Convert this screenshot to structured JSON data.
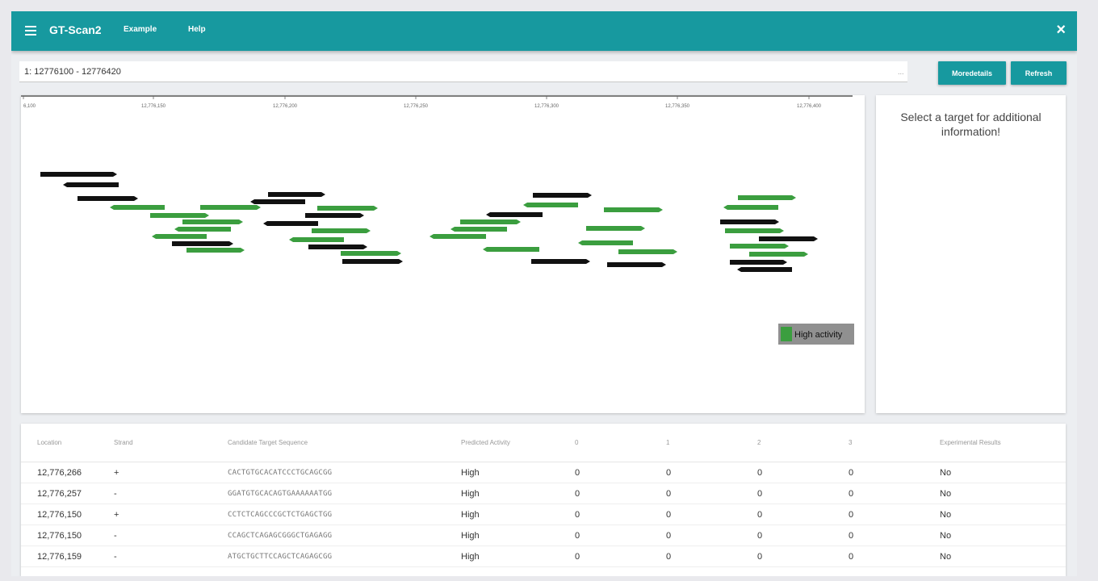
{
  "header": {
    "title": "GT-Scan2",
    "nav": [
      "Example",
      "Help"
    ],
    "close_symbol": "×"
  },
  "search": {
    "value": "1: 12776100 - 12776420",
    "trailing": "..."
  },
  "buttons": {
    "more_details": "Moredetails",
    "refresh": "Refresh"
  },
  "ruler": {
    "ticks": [
      "6,100",
      "12,776,150",
      "12,776,200",
      "12,776,250",
      "12,776,300",
      "12,776,350",
      "12,776,400"
    ]
  },
  "legend": {
    "label": "High activity",
    "color": "#3b9e3f"
  },
  "colors": {
    "accent": "#17999f",
    "high_activity": "#3b9e3f",
    "other": "#111111"
  },
  "info_panel": {
    "message": "Select a target for additional information!"
  },
  "table": {
    "columns": [
      "Location",
      "Strand",
      "Candidate Target Sequence",
      "Predicted Activity",
      "0",
      "1",
      "2",
      "3",
      "Experimental Results"
    ],
    "rows": [
      [
        "12,776,266",
        "+",
        "CACTGTGCACATCCCTGCAGCGG",
        "High",
        "0",
        "0",
        "0",
        "0",
        "No"
      ],
      [
        "12,776,257",
        "-",
        "GGATGTGCACAGTGAAAAAATGG",
        "High",
        "0",
        "0",
        "0",
        "0",
        "No"
      ],
      [
        "12,776,150",
        "+",
        "CCTCTCAGCCCGCTCTGAGCTGG",
        "High",
        "0",
        "0",
        "0",
        "0",
        "No"
      ],
      [
        "12,776,150",
        "-",
        "CCAGCTCAGAGCGGGCTGAGAGG",
        "High",
        "0",
        "0",
        "0",
        "0",
        "No"
      ],
      [
        "12,776,159",
        "-",
        "ATGCTGCTTCCAGCTCAGAGCGG",
        "High",
        "0",
        "0",
        "0",
        "0",
        "No"
      ]
    ]
  }
}
